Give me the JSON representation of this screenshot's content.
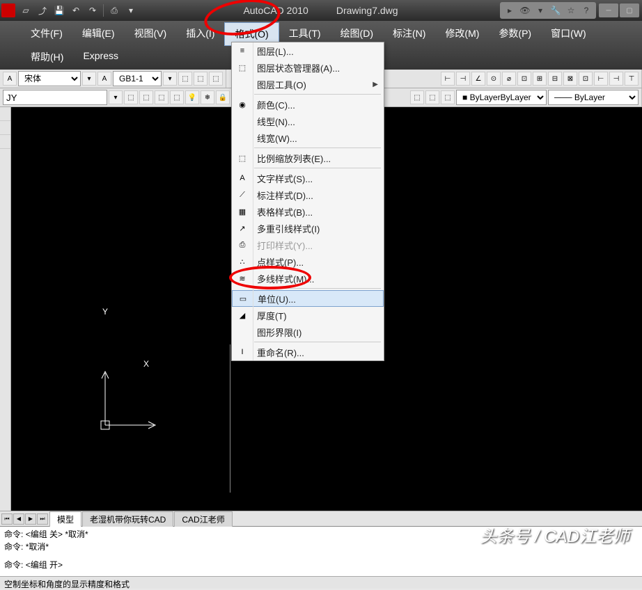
{
  "title": {
    "app": "AutoCAD 2010",
    "doc": "Drawing7.dwg"
  },
  "menu": {
    "items": [
      "文件(F)",
      "编辑(E)",
      "视图(V)",
      "插入(I)",
      "格式(O)",
      "工具(T)",
      "绘图(D)",
      "标注(N)",
      "修改(M)",
      "参数(P)",
      "窗口(W)",
      "帮助(H)",
      "Express"
    ],
    "active_index": 4
  },
  "toolbar": {
    "font": "宋体",
    "gb": "GB1-1",
    "layer_input": "JY",
    "bylayer": "ByLayer",
    "bylayer2": "ByLayer"
  },
  "dropdown": [
    {
      "type": "item",
      "icon": "layers-icon",
      "label": "图层(L)..."
    },
    {
      "type": "item",
      "icon": "layer-states-icon",
      "label": "图层状态管理器(A)..."
    },
    {
      "type": "item",
      "icon": "",
      "label": "图层工具(O)",
      "sub": true
    },
    {
      "type": "sep"
    },
    {
      "type": "item",
      "icon": "color-wheel-icon",
      "label": "颜色(C)..."
    },
    {
      "type": "item",
      "icon": "",
      "label": "线型(N)..."
    },
    {
      "type": "item",
      "icon": "",
      "label": "线宽(W)..."
    },
    {
      "type": "sep"
    },
    {
      "type": "item",
      "icon": "scale-list-icon",
      "label": "比例缩放列表(E)..."
    },
    {
      "type": "sep"
    },
    {
      "type": "item",
      "icon": "text-style-icon",
      "label": "文字样式(S)..."
    },
    {
      "type": "item",
      "icon": "dim-style-icon",
      "label": "标注样式(D)..."
    },
    {
      "type": "item",
      "icon": "table-style-icon",
      "label": "表格样式(B)..."
    },
    {
      "type": "item",
      "icon": "mleader-icon",
      "label": "多重引线样式(I)"
    },
    {
      "type": "item",
      "icon": "plot-style-icon",
      "label": "打印样式(Y)...",
      "disabled": true
    },
    {
      "type": "item",
      "icon": "point-style-icon",
      "label": "点样式(P)..."
    },
    {
      "type": "item",
      "icon": "mline-style-icon",
      "label": "多线样式(M)..."
    },
    {
      "type": "sep"
    },
    {
      "type": "item",
      "icon": "units-icon",
      "label": "单位(U)...",
      "highlight": true
    },
    {
      "type": "item",
      "icon": "thickness-icon",
      "label": "厚度(T)"
    },
    {
      "type": "item",
      "icon": "",
      "label": "图形界限(I)"
    },
    {
      "type": "sep"
    },
    {
      "type": "item",
      "icon": "rename-icon",
      "label": "重命名(R)..."
    }
  ],
  "ucs": {
    "x": "X",
    "y": "Y"
  },
  "tabs": {
    "items": [
      "模型",
      "老湿机带你玩转CAD",
      "CAD江老师"
    ],
    "active_index": 0
  },
  "cmd": {
    "prefix": "命令:",
    "line1": "<编组 关> *取消*",
    "line2": "*取消*",
    "line3": "<编组 开>"
  },
  "status": "空制坐标和角度的显示精度和格式",
  "watermark": "头条号 / CAD江老师",
  "icons": {
    "color": "◉",
    "scale": "⬚",
    "text": "A",
    "dim": "⟋",
    "table": "▦",
    "mleader": "↗",
    "plot": "⎙",
    "point": "∴",
    "mline": "≋",
    "units": "▭",
    "thick": "◢",
    "rename": "I",
    "layers": "≡",
    "states": "⬚"
  }
}
